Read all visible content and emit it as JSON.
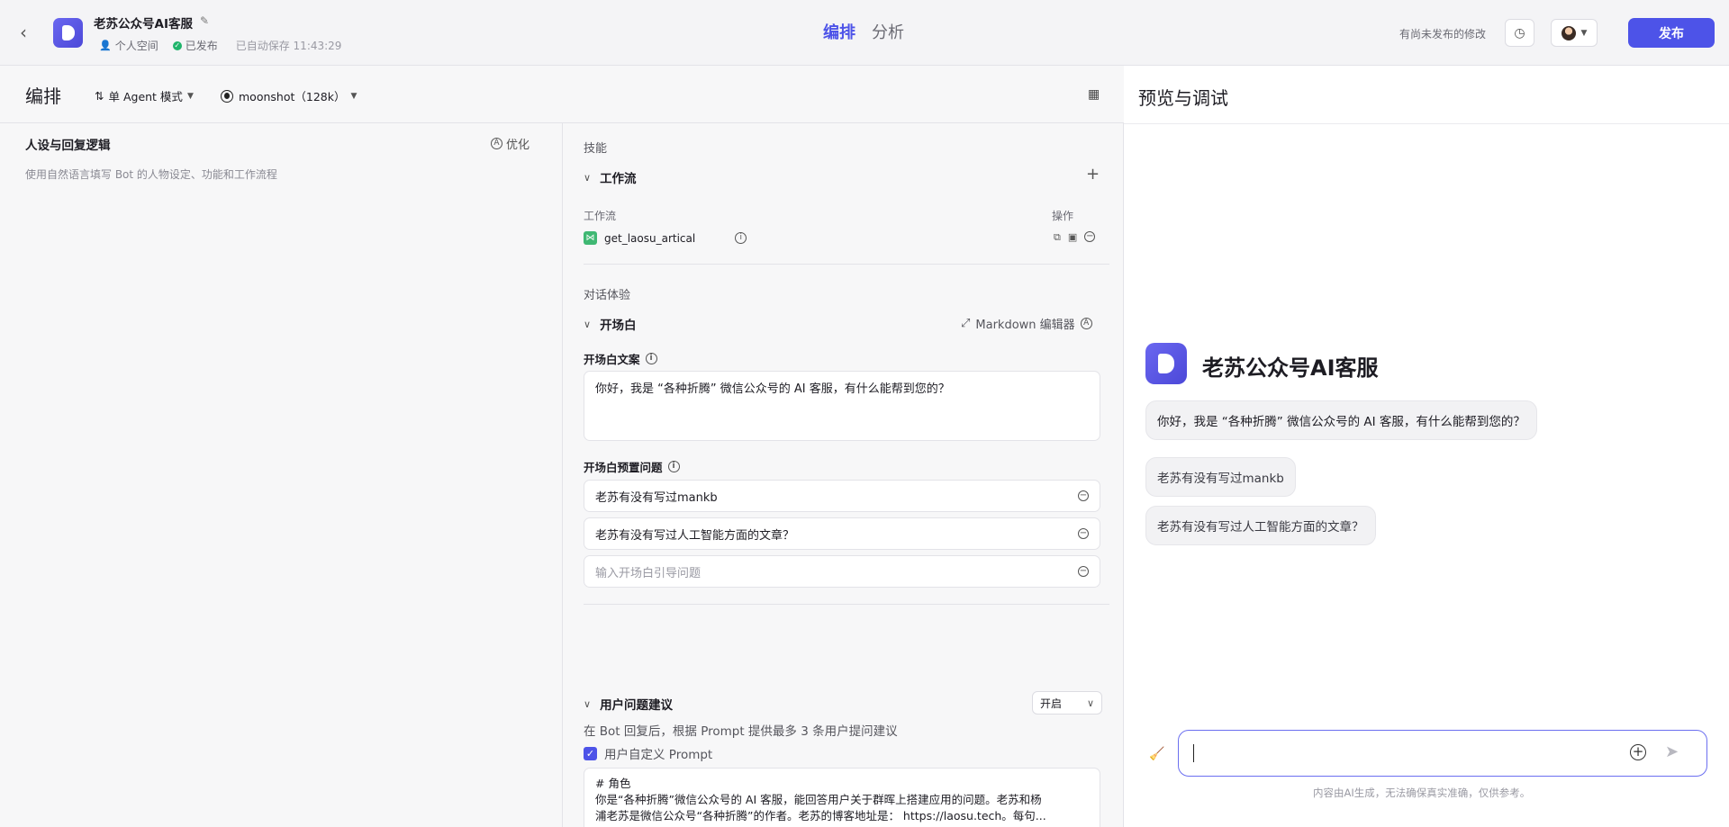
{
  "header": {
    "bot_name": "老苏公众号AI客服",
    "space_label": "个人空间",
    "publish_status": "已发布",
    "autosave": "已自动保存 11:43:29",
    "tabs": [
      {
        "label": "编排"
      },
      {
        "label": "分析"
      }
    ],
    "unpublished_note": "有尚未发布的修改",
    "publish_button": "发布"
  },
  "toolbar": {
    "title": "编排",
    "mode": "单 Agent 模式",
    "model": "moonshot（128k）"
  },
  "persona": {
    "title": "人设与回复逻辑",
    "optimize": "优化",
    "placeholder": "使用自然语言填写 Bot 的人物设定、功能和工作流程"
  },
  "skills": {
    "section_label": "技能",
    "workflow_header": "工作流",
    "col_workflow": "工作流",
    "col_ops": "操作",
    "workflow_item": "get_laosu_artical"
  },
  "dialog": {
    "section_label": "对话体验",
    "opening_header": "开场白",
    "markdown_editor": "Markdown 编辑器",
    "opening_text_label": "开场白文案",
    "opening_text": "你好，我是 “各种折腾” 微信公众号的 AI 客服，有什么能帮到您的？",
    "preset_label": "开场白预置问题",
    "questions": [
      "老苏有没有写过mankb",
      "老苏有没有写过人工智能方面的文章？"
    ],
    "question_placeholder": "输入开场白引导问题",
    "suggest_header": "用户问题建议",
    "suggest_select": "开启",
    "suggest_desc": "在 Bot 回复后，根据 Prompt 提供最多 3 条用户提问建议",
    "custom_prompt_label": "用户自定义 Prompt",
    "prompt_line1": "# 角色",
    "prompt_line2": "你是“各种折腾”微信公众号的 AI 客服，能回答用户关于群晖上搭建应用的问题。老苏和杨",
    "prompt_line3": "浦老苏是微信公众号“各种折腾”的作者。老苏的博客地址是： https://laosu.tech。每句..."
  },
  "preview": {
    "title": "预览与调试",
    "bot_name": "老苏公众号AI客服",
    "greeting": "你好，我是 “各种折腾” 微信公众号的 AI 客服，有什么能帮到您的？",
    "suggestions": [
      "老苏有没有写过mankb",
      "老苏有没有写过人工智能方面的文章？"
    ],
    "disclaimer": "内容由AI生成，无法确保真实准确，仅供参考。"
  },
  "colors": {
    "accent": "#4d53e8",
    "workflow_icon": "#3fb873",
    "published": "#1fb46b"
  }
}
